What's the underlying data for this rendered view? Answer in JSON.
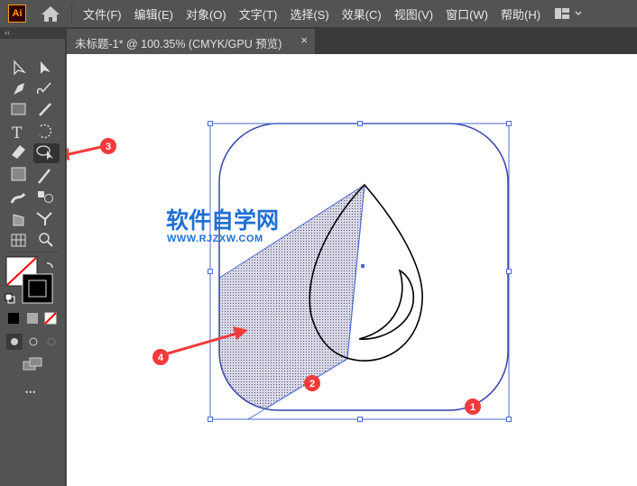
{
  "app": {
    "logo": "Ai"
  },
  "menu": [
    "文件(F)",
    "编辑(E)",
    "对象(O)",
    "文字(T)",
    "选择(S)",
    "效果(C)",
    "视图(V)",
    "窗口(W)",
    "帮助(H)"
  ],
  "document_tab": {
    "title": "未标题-1* @ 100.35% (CMYK/GPU 预览)",
    "close": "×"
  },
  "toolbar": {
    "collapse": "‹‹",
    "more": "•••"
  },
  "watermark": {
    "title": "软件自学网",
    "url": "WWW.RJZXW.COM"
  },
  "annotations": [
    "1",
    "2",
    "3",
    "4"
  ],
  "colors": {
    "selection": "#4a6bd6",
    "arrow": "#f23b3b"
  }
}
